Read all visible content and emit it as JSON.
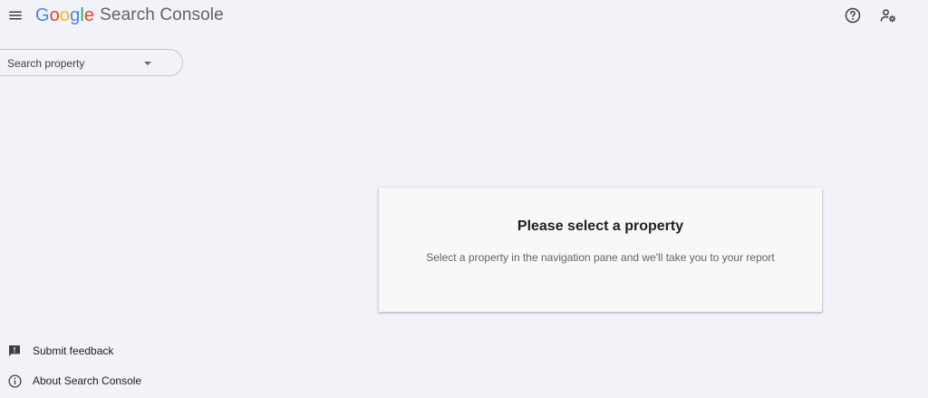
{
  "header": {
    "logo_letters": [
      "G",
      "o",
      "o",
      "g",
      "l",
      "e"
    ],
    "product_name": "Search Console"
  },
  "property_selector": {
    "label": "Search property"
  },
  "card": {
    "title": "Please select a property",
    "message": "Select a property in the navigation pane and we'll take you to your report"
  },
  "footer": {
    "feedback_label": "Submit feedback",
    "about_label": "About Search Console"
  },
  "colors": {
    "google_blue": "#4285f4",
    "google_red": "#ea4335",
    "google_yellow": "#fbbc05",
    "google_green": "#34a853",
    "background": "#f1f3f8",
    "icon_gray": "#5f6368"
  },
  "icons": {
    "menu": "hamburger-menu-icon",
    "help": "help-circle-icon",
    "settings": "user-settings-icon",
    "dropdown": "arrow-drop-down-icon",
    "feedback": "feedback-icon",
    "info": "info-icon"
  }
}
